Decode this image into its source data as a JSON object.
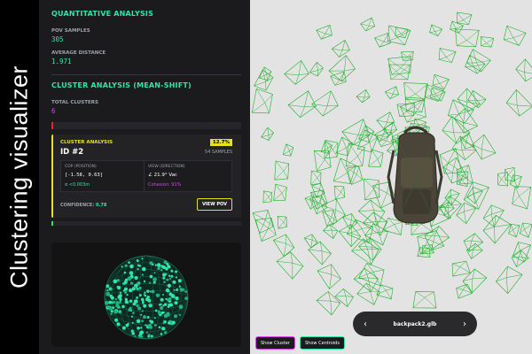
{
  "overlay_title": "Clustering visualizer",
  "quant": {
    "title": "QUANTITATIVE ANALYSIS",
    "pov_label": "POV SAMPLES",
    "pov_value": "305",
    "dist_label": "AVERAGE DISTANCE",
    "dist_value": "1.971"
  },
  "cluster_analysis": {
    "title": "CLUSTER ANALYSIS (MEAN-SHIFT)",
    "total_label": "TOTAL CLUSTERS",
    "total_value": "6"
  },
  "card": {
    "heading": "CLUSTER ANALYSIS",
    "id": "ID #2",
    "percent": "12.7%",
    "samples": "54 SAMPLES",
    "cop_label": "COP (POSITION)",
    "cop_value": "[-1.58, 0.63]",
    "cop_sigma": "σ <0.003m",
    "view_label": "VIEW (DIRECTION)",
    "view_value": "∠ 21.9° Var.",
    "view_cohesion": "Cohesion: 91%",
    "confidence_label": "CONFIDENCE:",
    "confidence_value": "0.78",
    "view_pov_label": "VIEW POV"
  },
  "viewer": {
    "model_name": "backpack2.glb",
    "prev_icon": "‹",
    "next_icon": "›"
  },
  "toolbar": {
    "show_cluster": "Show Cluster",
    "show_centroids": "Show Centroids"
  },
  "colors": {
    "accent_green": "#2ee6a8",
    "magenta": "#d646e6",
    "yellow": "#e8e21c",
    "frustum_green": "#1fae2a"
  }
}
